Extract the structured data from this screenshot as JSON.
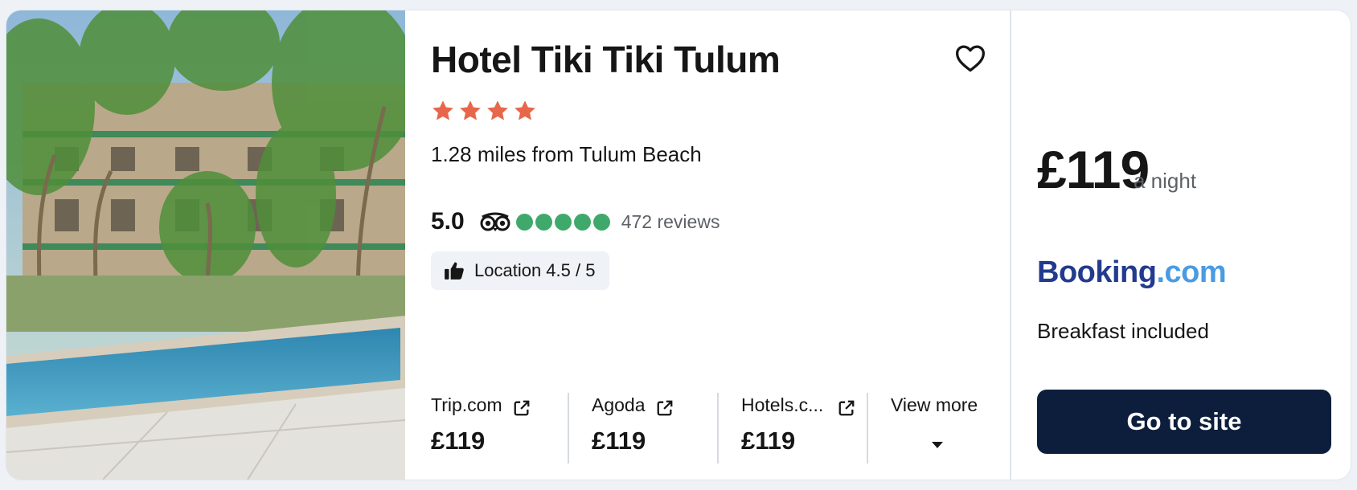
{
  "hotel": {
    "name": "Hotel Tiki Tiki Tulum",
    "star_rating": 4,
    "distance": "1.28 miles from Tulum Beach",
    "favorite_icon": "heart-outline-icon"
  },
  "reviews": {
    "score": "5.0",
    "source_icon": "tripadvisor-owl-icon",
    "bubbles_filled": 5,
    "bubbles_total": 5,
    "count": "472 reviews",
    "location_chip": "Location 4.5 / 5",
    "chip_icon": "thumbs-up-icon"
  },
  "providers": [
    {
      "name": "Trip.com",
      "price": "£119",
      "icon": "external-link-icon"
    },
    {
      "name": "Agoda",
      "price": "£119",
      "icon": "external-link-icon"
    },
    {
      "name": "Hotels.c...",
      "price": "£119",
      "icon": "external-link-icon"
    }
  ],
  "view_more": {
    "label": "View more",
    "icon": "caret-down-icon"
  },
  "deal": {
    "price": "£119",
    "per": "a night",
    "provider_part1": "Booking",
    "provider_part2": ".com",
    "perk": "Breakfast included",
    "cta": "Go to site"
  },
  "colors": {
    "star": "#e8674a",
    "bubble": "#3fa96b",
    "cta_bg": "#0d1e3c",
    "booking_dark": "#223b8f",
    "booking_light": "#4a9be2"
  }
}
